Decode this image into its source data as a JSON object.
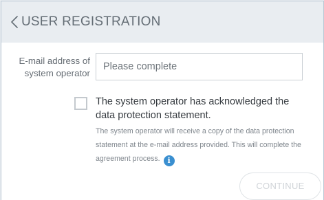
{
  "header": {
    "back_icon": "chevron-left-icon",
    "title": "USER REGISTRATION"
  },
  "form": {
    "email_label_line1": "E-mail address of",
    "email_label_line2": "system operator",
    "email_value": "",
    "email_placeholder": "Please complete",
    "acknowledge_checked": false,
    "acknowledge_label": "The system operator has acknowledged the data protection statement.",
    "help_text": "The system operator will receive a copy of the data protection statement at the e-mail address provided. This will complete the agreement process.",
    "info_icon": "info-icon",
    "info_glyph": "i",
    "continue_label": "CONTINUE",
    "continue_enabled": false
  },
  "colors": {
    "header_bg": "#e9edf1",
    "title_text": "#646d75",
    "info_accent": "#3a8fd0",
    "disabled_text": "#d0d4d8"
  }
}
